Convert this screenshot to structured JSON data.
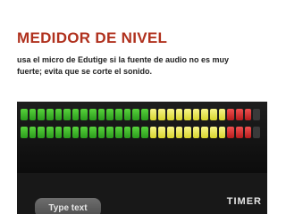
{
  "slide": {
    "title": "MEDIDOR DE NIVEL",
    "description": "usa el micro de Edutige si la fuente de audio no es muy fuerte; evita que se corte el sonido."
  },
  "screenshot": {
    "meter": {
      "segments": [
        "green",
        "green",
        "green",
        "green",
        "green",
        "green",
        "green",
        "green",
        "green",
        "green",
        "green",
        "green",
        "green",
        "green",
        "green",
        "yellow",
        "yellow",
        "yellow",
        "yellow",
        "yellow",
        "yellow",
        "yellow",
        "yellow",
        "yellow",
        "red",
        "red",
        "red",
        "off"
      ],
      "colors": {
        "green": "#3fbf2a",
        "yellow": "#e8e64a",
        "red": "#d32f2f",
        "off": "#3a3a3a"
      }
    },
    "type_button_label": "Type text",
    "timer_label": "TIMER"
  }
}
